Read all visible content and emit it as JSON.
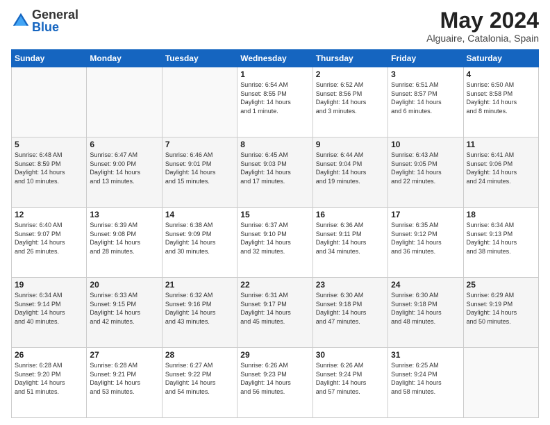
{
  "logo": {
    "general": "General",
    "blue": "Blue"
  },
  "title": "May 2024",
  "location": "Alguaire, Catalonia, Spain",
  "headers": [
    "Sunday",
    "Monday",
    "Tuesday",
    "Wednesday",
    "Thursday",
    "Friday",
    "Saturday"
  ],
  "weeks": [
    [
      {
        "day": "",
        "info": ""
      },
      {
        "day": "",
        "info": ""
      },
      {
        "day": "",
        "info": ""
      },
      {
        "day": "1",
        "info": "Sunrise: 6:54 AM\nSunset: 8:55 PM\nDaylight: 14 hours\nand 1 minute."
      },
      {
        "day": "2",
        "info": "Sunrise: 6:52 AM\nSunset: 8:56 PM\nDaylight: 14 hours\nand 3 minutes."
      },
      {
        "day": "3",
        "info": "Sunrise: 6:51 AM\nSunset: 8:57 PM\nDaylight: 14 hours\nand 6 minutes."
      },
      {
        "day": "4",
        "info": "Sunrise: 6:50 AM\nSunset: 8:58 PM\nDaylight: 14 hours\nand 8 minutes."
      }
    ],
    [
      {
        "day": "5",
        "info": "Sunrise: 6:48 AM\nSunset: 8:59 PM\nDaylight: 14 hours\nand 10 minutes."
      },
      {
        "day": "6",
        "info": "Sunrise: 6:47 AM\nSunset: 9:00 PM\nDaylight: 14 hours\nand 13 minutes."
      },
      {
        "day": "7",
        "info": "Sunrise: 6:46 AM\nSunset: 9:01 PM\nDaylight: 14 hours\nand 15 minutes."
      },
      {
        "day": "8",
        "info": "Sunrise: 6:45 AM\nSunset: 9:03 PM\nDaylight: 14 hours\nand 17 minutes."
      },
      {
        "day": "9",
        "info": "Sunrise: 6:44 AM\nSunset: 9:04 PM\nDaylight: 14 hours\nand 19 minutes."
      },
      {
        "day": "10",
        "info": "Sunrise: 6:43 AM\nSunset: 9:05 PM\nDaylight: 14 hours\nand 22 minutes."
      },
      {
        "day": "11",
        "info": "Sunrise: 6:41 AM\nSunset: 9:06 PM\nDaylight: 14 hours\nand 24 minutes."
      }
    ],
    [
      {
        "day": "12",
        "info": "Sunrise: 6:40 AM\nSunset: 9:07 PM\nDaylight: 14 hours\nand 26 minutes."
      },
      {
        "day": "13",
        "info": "Sunrise: 6:39 AM\nSunset: 9:08 PM\nDaylight: 14 hours\nand 28 minutes."
      },
      {
        "day": "14",
        "info": "Sunrise: 6:38 AM\nSunset: 9:09 PM\nDaylight: 14 hours\nand 30 minutes."
      },
      {
        "day": "15",
        "info": "Sunrise: 6:37 AM\nSunset: 9:10 PM\nDaylight: 14 hours\nand 32 minutes."
      },
      {
        "day": "16",
        "info": "Sunrise: 6:36 AM\nSunset: 9:11 PM\nDaylight: 14 hours\nand 34 minutes."
      },
      {
        "day": "17",
        "info": "Sunrise: 6:35 AM\nSunset: 9:12 PM\nDaylight: 14 hours\nand 36 minutes."
      },
      {
        "day": "18",
        "info": "Sunrise: 6:34 AM\nSunset: 9:13 PM\nDaylight: 14 hours\nand 38 minutes."
      }
    ],
    [
      {
        "day": "19",
        "info": "Sunrise: 6:34 AM\nSunset: 9:14 PM\nDaylight: 14 hours\nand 40 minutes."
      },
      {
        "day": "20",
        "info": "Sunrise: 6:33 AM\nSunset: 9:15 PM\nDaylight: 14 hours\nand 42 minutes."
      },
      {
        "day": "21",
        "info": "Sunrise: 6:32 AM\nSunset: 9:16 PM\nDaylight: 14 hours\nand 43 minutes."
      },
      {
        "day": "22",
        "info": "Sunrise: 6:31 AM\nSunset: 9:17 PM\nDaylight: 14 hours\nand 45 minutes."
      },
      {
        "day": "23",
        "info": "Sunrise: 6:30 AM\nSunset: 9:18 PM\nDaylight: 14 hours\nand 47 minutes."
      },
      {
        "day": "24",
        "info": "Sunrise: 6:30 AM\nSunset: 9:18 PM\nDaylight: 14 hours\nand 48 minutes."
      },
      {
        "day": "25",
        "info": "Sunrise: 6:29 AM\nSunset: 9:19 PM\nDaylight: 14 hours\nand 50 minutes."
      }
    ],
    [
      {
        "day": "26",
        "info": "Sunrise: 6:28 AM\nSunset: 9:20 PM\nDaylight: 14 hours\nand 51 minutes."
      },
      {
        "day": "27",
        "info": "Sunrise: 6:28 AM\nSunset: 9:21 PM\nDaylight: 14 hours\nand 53 minutes."
      },
      {
        "day": "28",
        "info": "Sunrise: 6:27 AM\nSunset: 9:22 PM\nDaylight: 14 hours\nand 54 minutes."
      },
      {
        "day": "29",
        "info": "Sunrise: 6:26 AM\nSunset: 9:23 PM\nDaylight: 14 hours\nand 56 minutes."
      },
      {
        "day": "30",
        "info": "Sunrise: 6:26 AM\nSunset: 9:24 PM\nDaylight: 14 hours\nand 57 minutes."
      },
      {
        "day": "31",
        "info": "Sunrise: 6:25 AM\nSunset: 9:24 PM\nDaylight: 14 hours\nand 58 minutes."
      },
      {
        "day": "",
        "info": ""
      }
    ]
  ]
}
